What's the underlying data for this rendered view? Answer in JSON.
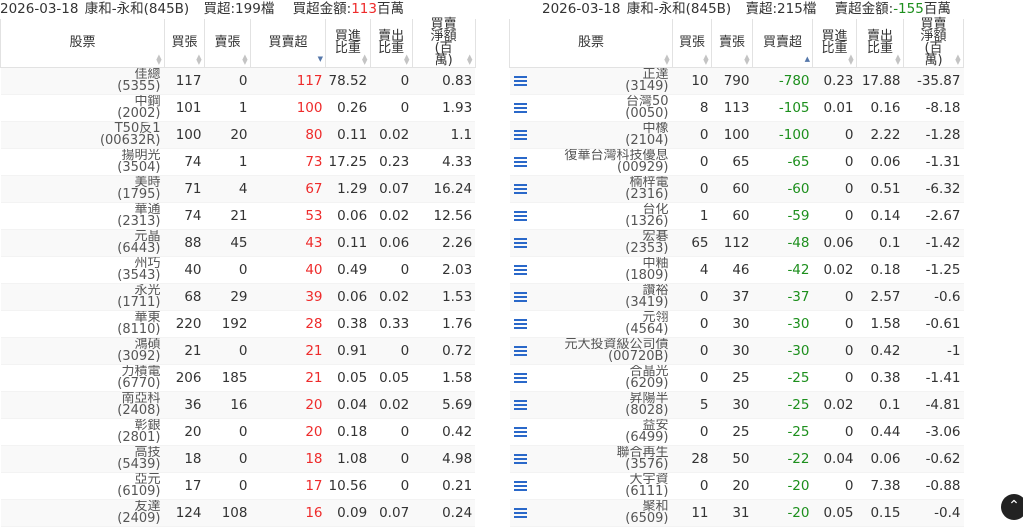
{
  "left": {
    "title": {
      "date": "2026-03-18",
      "broker": "康和-永和(845B)",
      "count_label": "買超:199檔",
      "amount_label": "買超金額:",
      "amount_value": "113",
      "amount_unit": "百萬"
    },
    "headers": [
      "股票",
      "買張",
      "賣張",
      "買賣超",
      "買進比重",
      "賣出比重",
      "買賣淨額(百萬)"
    ],
    "rows": [
      {
        "name": "佳總",
        "code": "(5355)",
        "buy": "117",
        "sell": "0",
        "net": "117",
        "buy_pct": "78.52",
        "sell_pct": "0",
        "amount": "0.83"
      },
      {
        "name": "中鋼",
        "code": "(2002)",
        "buy": "101",
        "sell": "1",
        "net": "100",
        "buy_pct": "0.26",
        "sell_pct": "0",
        "amount": "1.93"
      },
      {
        "name": "T50反1",
        "code": "(00632R)",
        "buy": "100",
        "sell": "20",
        "net": "80",
        "buy_pct": "0.11",
        "sell_pct": "0.02",
        "amount": "1.1"
      },
      {
        "name": "揚明光",
        "code": "(3504)",
        "buy": "74",
        "sell": "1",
        "net": "73",
        "buy_pct": "17.25",
        "sell_pct": "0.23",
        "amount": "4.33"
      },
      {
        "name": "美時",
        "code": "(1795)",
        "buy": "71",
        "sell": "4",
        "net": "67",
        "buy_pct": "1.29",
        "sell_pct": "0.07",
        "amount": "16.24"
      },
      {
        "name": "華通",
        "code": "(2313)",
        "buy": "74",
        "sell": "21",
        "net": "53",
        "buy_pct": "0.06",
        "sell_pct": "0.02",
        "amount": "12.56"
      },
      {
        "name": "元晶",
        "code": "(6443)",
        "buy": "88",
        "sell": "45",
        "net": "43",
        "buy_pct": "0.11",
        "sell_pct": "0.06",
        "amount": "2.26"
      },
      {
        "name": "州巧",
        "code": "(3543)",
        "buy": "40",
        "sell": "0",
        "net": "40",
        "buy_pct": "0.49",
        "sell_pct": "0",
        "amount": "2.03"
      },
      {
        "name": "永光",
        "code": "(1711)",
        "buy": "68",
        "sell": "29",
        "net": "39",
        "buy_pct": "0.06",
        "sell_pct": "0.02",
        "amount": "1.53"
      },
      {
        "name": "華東",
        "code": "(8110)",
        "buy": "220",
        "sell": "192",
        "net": "28",
        "buy_pct": "0.38",
        "sell_pct": "0.33",
        "amount": "1.76"
      },
      {
        "name": "鴻碩",
        "code": "(3092)",
        "buy": "21",
        "sell": "0",
        "net": "21",
        "buy_pct": "0.91",
        "sell_pct": "0",
        "amount": "0.72"
      },
      {
        "name": "力積電",
        "code": "(6770)",
        "buy": "206",
        "sell": "185",
        "net": "21",
        "buy_pct": "0.05",
        "sell_pct": "0.05",
        "amount": "1.58"
      },
      {
        "name": "南亞科",
        "code": "(2408)",
        "buy": "36",
        "sell": "16",
        "net": "20",
        "buy_pct": "0.04",
        "sell_pct": "0.02",
        "amount": "5.69"
      },
      {
        "name": "彰銀",
        "code": "(2801)",
        "buy": "20",
        "sell": "0",
        "net": "20",
        "buy_pct": "0.18",
        "sell_pct": "0",
        "amount": "0.42"
      },
      {
        "name": "高技",
        "code": "(5439)",
        "buy": "18",
        "sell": "0",
        "net": "18",
        "buy_pct": "1.08",
        "sell_pct": "0",
        "amount": "4.98"
      },
      {
        "name": "亞元",
        "code": "(6109)",
        "buy": "17",
        "sell": "0",
        "net": "17",
        "buy_pct": "10.56",
        "sell_pct": "0",
        "amount": "0.21"
      },
      {
        "name": "友達",
        "code": "(2409)",
        "buy": "124",
        "sell": "108",
        "net": "16",
        "buy_pct": "0.09",
        "sell_pct": "0.07",
        "amount": "0.24"
      }
    ]
  },
  "right": {
    "title": {
      "date": "2026-03-18",
      "broker": "康和-永和(845B)",
      "count_label": "賣超:215檔",
      "amount_label": "賣超金額:",
      "amount_value": "-155",
      "amount_unit": "百萬"
    },
    "headers": [
      "股票",
      "買張",
      "賣張",
      "買賣超",
      "買進比重",
      "賣出比重",
      "買賣淨額(百萬)"
    ],
    "rows": [
      {
        "name": "正達",
        "code": "(3149)",
        "buy": "10",
        "sell": "790",
        "net": "-780",
        "buy_pct": "0.23",
        "sell_pct": "17.88",
        "amount": "-35.87"
      },
      {
        "name": "台灣50",
        "code": "(0050)",
        "buy": "8",
        "sell": "113",
        "net": "-105",
        "buy_pct": "0.01",
        "sell_pct": "0.16",
        "amount": "-8.18"
      },
      {
        "name": "中橡",
        "code": "(2104)",
        "buy": "0",
        "sell": "100",
        "net": "-100",
        "buy_pct": "0",
        "sell_pct": "2.22",
        "amount": "-1.28"
      },
      {
        "name": "復華台灣科技優息",
        "code": "(00929)",
        "buy": "0",
        "sell": "65",
        "net": "-65",
        "buy_pct": "0",
        "sell_pct": "0.06",
        "amount": "-1.31"
      },
      {
        "name": "楠梓電",
        "code": "(2316)",
        "buy": "0",
        "sell": "60",
        "net": "-60",
        "buy_pct": "0",
        "sell_pct": "0.51",
        "amount": "-6.32"
      },
      {
        "name": "台化",
        "code": "(1326)",
        "buy": "1",
        "sell": "60",
        "net": "-59",
        "buy_pct": "0",
        "sell_pct": "0.14",
        "amount": "-2.67"
      },
      {
        "name": "宏碁",
        "code": "(2353)",
        "buy": "65",
        "sell": "112",
        "net": "-48",
        "buy_pct": "0.06",
        "sell_pct": "0.1",
        "amount": "-1.42"
      },
      {
        "name": "中釉",
        "code": "(1809)",
        "buy": "4",
        "sell": "46",
        "net": "-42",
        "buy_pct": "0.02",
        "sell_pct": "0.18",
        "amount": "-1.25"
      },
      {
        "name": "讚裕",
        "code": "(3419)",
        "buy": "0",
        "sell": "37",
        "net": "-37",
        "buy_pct": "0",
        "sell_pct": "2.57",
        "amount": "-0.6"
      },
      {
        "name": "元翎",
        "code": "(4564)",
        "buy": "0",
        "sell": "30",
        "net": "-30",
        "buy_pct": "0",
        "sell_pct": "1.58",
        "amount": "-0.61"
      },
      {
        "name": "元大投資級公司債",
        "code": "(00720B)",
        "buy": "0",
        "sell": "30",
        "net": "-30",
        "buy_pct": "0",
        "sell_pct": "0.42",
        "amount": "-1"
      },
      {
        "name": "合晶光",
        "code": "(6209)",
        "buy": "0",
        "sell": "25",
        "net": "-25",
        "buy_pct": "0",
        "sell_pct": "0.38",
        "amount": "-1.41"
      },
      {
        "name": "昇陽半",
        "code": "(8028)",
        "buy": "5",
        "sell": "30",
        "net": "-25",
        "buy_pct": "0.02",
        "sell_pct": "0.1",
        "amount": "-4.81"
      },
      {
        "name": "益安",
        "code": "(6499)",
        "buy": "0",
        "sell": "25",
        "net": "-25",
        "buy_pct": "0",
        "sell_pct": "0.44",
        "amount": "-3.06"
      },
      {
        "name": "聯合再生",
        "code": "(3576)",
        "buy": "28",
        "sell": "50",
        "net": "-22",
        "buy_pct": "0.04",
        "sell_pct": "0.06",
        "amount": "-0.62"
      },
      {
        "name": "大宇資",
        "code": "(6111)",
        "buy": "0",
        "sell": "20",
        "net": "-20",
        "buy_pct": "0",
        "sell_pct": "7.38",
        "amount": "-0.88"
      },
      {
        "name": "聚和",
        "code": "(6509)",
        "buy": "11",
        "sell": "31",
        "net": "-20",
        "buy_pct": "0.05",
        "sell_pct": "0.15",
        "amount": "-0.4"
      }
    ]
  },
  "colors": {
    "positive": "#ee2b2b",
    "negative": "#1d8f1d",
    "menu_icon": "#2a68c9"
  },
  "icons": {
    "row_menu": "list-menu-icon",
    "sort": "sort-arrows-icon",
    "scroll_top": "chevron-up-icon"
  }
}
